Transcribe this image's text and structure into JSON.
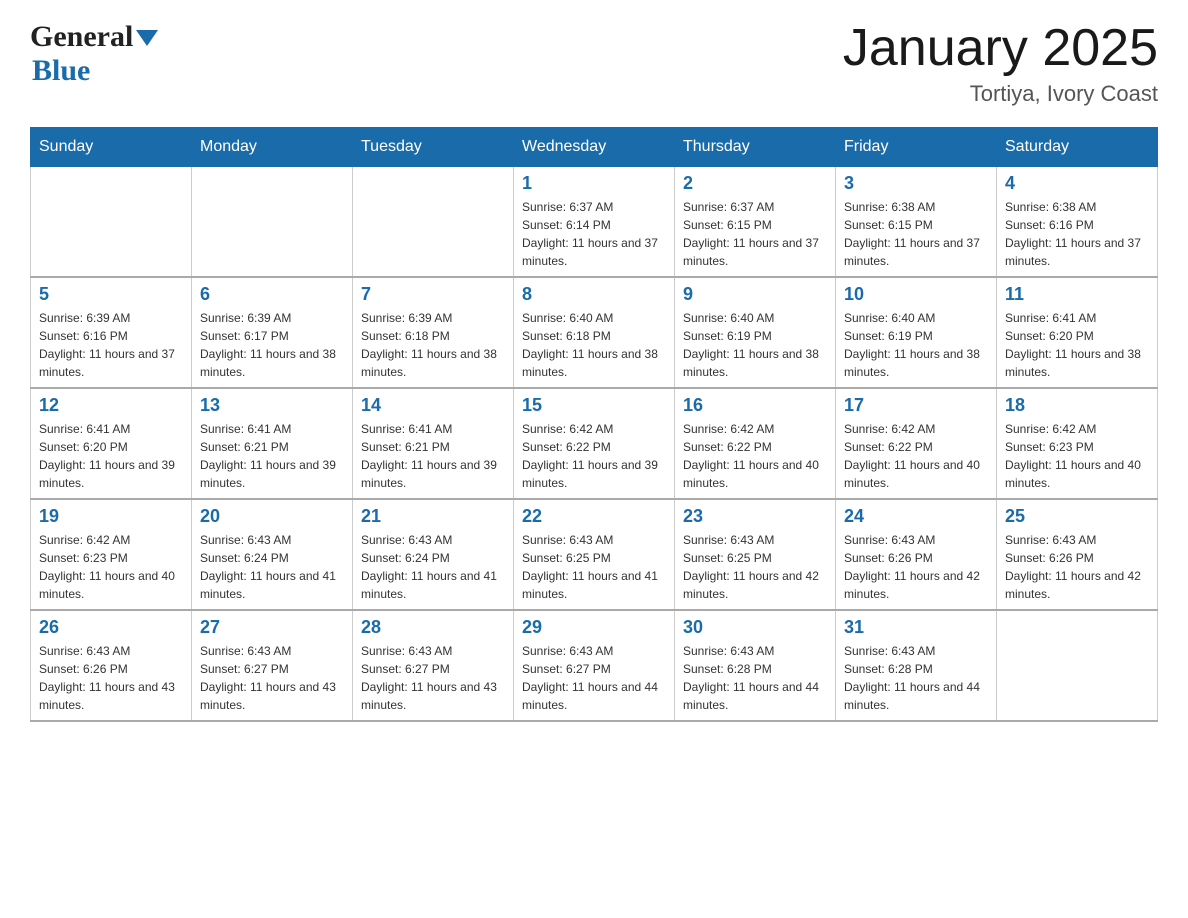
{
  "header": {
    "logo_general": "General",
    "logo_blue": "Blue",
    "title": "January 2025",
    "subtitle": "Tortiya, Ivory Coast"
  },
  "days_of_week": [
    "Sunday",
    "Monday",
    "Tuesday",
    "Wednesday",
    "Thursday",
    "Friday",
    "Saturday"
  ],
  "weeks": [
    [
      {
        "day": "",
        "info": ""
      },
      {
        "day": "",
        "info": ""
      },
      {
        "day": "",
        "info": ""
      },
      {
        "day": "1",
        "info": "Sunrise: 6:37 AM\nSunset: 6:14 PM\nDaylight: 11 hours and 37 minutes."
      },
      {
        "day": "2",
        "info": "Sunrise: 6:37 AM\nSunset: 6:15 PM\nDaylight: 11 hours and 37 minutes."
      },
      {
        "day": "3",
        "info": "Sunrise: 6:38 AM\nSunset: 6:15 PM\nDaylight: 11 hours and 37 minutes."
      },
      {
        "day": "4",
        "info": "Sunrise: 6:38 AM\nSunset: 6:16 PM\nDaylight: 11 hours and 37 minutes."
      }
    ],
    [
      {
        "day": "5",
        "info": "Sunrise: 6:39 AM\nSunset: 6:16 PM\nDaylight: 11 hours and 37 minutes."
      },
      {
        "day": "6",
        "info": "Sunrise: 6:39 AM\nSunset: 6:17 PM\nDaylight: 11 hours and 38 minutes."
      },
      {
        "day": "7",
        "info": "Sunrise: 6:39 AM\nSunset: 6:18 PM\nDaylight: 11 hours and 38 minutes."
      },
      {
        "day": "8",
        "info": "Sunrise: 6:40 AM\nSunset: 6:18 PM\nDaylight: 11 hours and 38 minutes."
      },
      {
        "day": "9",
        "info": "Sunrise: 6:40 AM\nSunset: 6:19 PM\nDaylight: 11 hours and 38 minutes."
      },
      {
        "day": "10",
        "info": "Sunrise: 6:40 AM\nSunset: 6:19 PM\nDaylight: 11 hours and 38 minutes."
      },
      {
        "day": "11",
        "info": "Sunrise: 6:41 AM\nSunset: 6:20 PM\nDaylight: 11 hours and 38 minutes."
      }
    ],
    [
      {
        "day": "12",
        "info": "Sunrise: 6:41 AM\nSunset: 6:20 PM\nDaylight: 11 hours and 39 minutes."
      },
      {
        "day": "13",
        "info": "Sunrise: 6:41 AM\nSunset: 6:21 PM\nDaylight: 11 hours and 39 minutes."
      },
      {
        "day": "14",
        "info": "Sunrise: 6:41 AM\nSunset: 6:21 PM\nDaylight: 11 hours and 39 minutes."
      },
      {
        "day": "15",
        "info": "Sunrise: 6:42 AM\nSunset: 6:22 PM\nDaylight: 11 hours and 39 minutes."
      },
      {
        "day": "16",
        "info": "Sunrise: 6:42 AM\nSunset: 6:22 PM\nDaylight: 11 hours and 40 minutes."
      },
      {
        "day": "17",
        "info": "Sunrise: 6:42 AM\nSunset: 6:22 PM\nDaylight: 11 hours and 40 minutes."
      },
      {
        "day": "18",
        "info": "Sunrise: 6:42 AM\nSunset: 6:23 PM\nDaylight: 11 hours and 40 minutes."
      }
    ],
    [
      {
        "day": "19",
        "info": "Sunrise: 6:42 AM\nSunset: 6:23 PM\nDaylight: 11 hours and 40 minutes."
      },
      {
        "day": "20",
        "info": "Sunrise: 6:43 AM\nSunset: 6:24 PM\nDaylight: 11 hours and 41 minutes."
      },
      {
        "day": "21",
        "info": "Sunrise: 6:43 AM\nSunset: 6:24 PM\nDaylight: 11 hours and 41 minutes."
      },
      {
        "day": "22",
        "info": "Sunrise: 6:43 AM\nSunset: 6:25 PM\nDaylight: 11 hours and 41 minutes."
      },
      {
        "day": "23",
        "info": "Sunrise: 6:43 AM\nSunset: 6:25 PM\nDaylight: 11 hours and 42 minutes."
      },
      {
        "day": "24",
        "info": "Sunrise: 6:43 AM\nSunset: 6:26 PM\nDaylight: 11 hours and 42 minutes."
      },
      {
        "day": "25",
        "info": "Sunrise: 6:43 AM\nSunset: 6:26 PM\nDaylight: 11 hours and 42 minutes."
      }
    ],
    [
      {
        "day": "26",
        "info": "Sunrise: 6:43 AM\nSunset: 6:26 PM\nDaylight: 11 hours and 43 minutes."
      },
      {
        "day": "27",
        "info": "Sunrise: 6:43 AM\nSunset: 6:27 PM\nDaylight: 11 hours and 43 minutes."
      },
      {
        "day": "28",
        "info": "Sunrise: 6:43 AM\nSunset: 6:27 PM\nDaylight: 11 hours and 43 minutes."
      },
      {
        "day": "29",
        "info": "Sunrise: 6:43 AM\nSunset: 6:27 PM\nDaylight: 11 hours and 44 minutes."
      },
      {
        "day": "30",
        "info": "Sunrise: 6:43 AM\nSunset: 6:28 PM\nDaylight: 11 hours and 44 minutes."
      },
      {
        "day": "31",
        "info": "Sunrise: 6:43 AM\nSunset: 6:28 PM\nDaylight: 11 hours and 44 minutes."
      },
      {
        "day": "",
        "info": ""
      }
    ]
  ]
}
